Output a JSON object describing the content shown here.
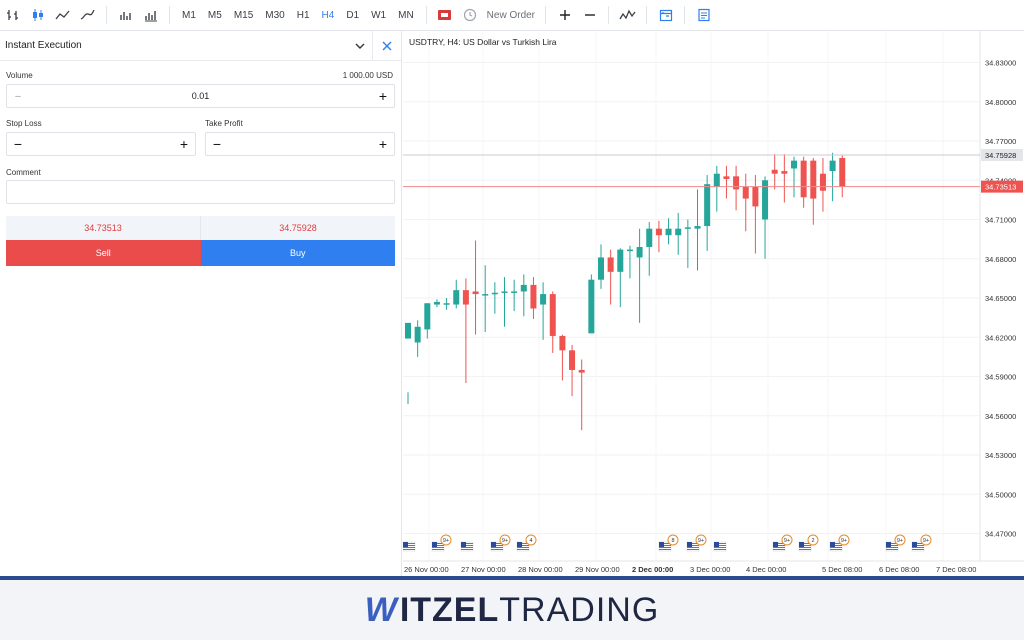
{
  "toolbar": {
    "timeframes": [
      "M1",
      "M5",
      "M15",
      "M30",
      "H1",
      "H4",
      "D1",
      "W1",
      "MN"
    ],
    "active_timeframe": "H4",
    "new_order_label": "New Order"
  },
  "order_panel": {
    "title": "Instant Execution",
    "volume_label": "Volume",
    "volume_value_usd": "1 000.00 USD",
    "volume": "0.01",
    "stop_loss_label": "Stop Loss",
    "take_profit_label": "Take Profit",
    "comment_label": "Comment",
    "sell_price": "34.73513",
    "buy_price": "34.75928",
    "sell_label": "Sell",
    "buy_label": "Buy"
  },
  "chart": {
    "title": "USDTRY, H4: US Dollar vs Turkish Lira",
    "price_labels": [
      "34.83000",
      "34.80000",
      "34.77000",
      "34.74000",
      "34.71000",
      "34.68000",
      "34.65000",
      "34.62000",
      "34.59000",
      "34.56000",
      "34.53000",
      "34.50000",
      "34.47000"
    ],
    "ask_price": "34.75928",
    "bid_price": "34.73513",
    "time_labels": [
      "26 Nov 00:00",
      "27 Nov 00:00",
      "28 Nov 00:00",
      "29 Nov 00:00",
      "2 Dec 00:00",
      "3 Dec 00:00",
      "4 Dec 00:00",
      "5 Dec 08:00",
      "6 Dec 08:00",
      "7 Dec 08:00"
    ],
    "event_badges": [
      "9+",
      "9+",
      "4",
      "8",
      "9+",
      "9+",
      "2",
      "9+",
      "9+",
      "9+"
    ]
  },
  "chart_data": {
    "type": "candlestick",
    "series": "USDTRY H4",
    "ylim": [
      34.455,
      34.845
    ],
    "candles": [
      [
        34.619,
        34.631,
        34.578,
        34.569
      ],
      [
        34.616,
        34.628,
        34.633,
        34.605
      ],
      [
        34.626,
        34.646,
        34.646,
        34.619
      ],
      [
        34.645,
        34.647,
        34.649,
        34.643
      ],
      [
        34.645,
        34.646,
        34.65,
        34.641
      ],
      [
        34.645,
        34.656,
        34.664,
        34.642
      ],
      [
        34.656,
        34.645,
        34.665,
        34.585
      ],
      [
        34.655,
        34.653,
        34.694,
        34.622
      ],
      [
        34.653,
        34.653,
        34.675,
        34.624
      ],
      [
        34.653,
        34.654,
        34.662,
        34.638
      ],
      [
        34.654,
        34.655,
        34.666,
        34.628
      ],
      [
        34.655,
        34.655,
        34.664,
        34.64
      ],
      [
        34.655,
        34.66,
        34.668,
        34.636
      ],
      [
        34.66,
        34.642,
        34.666,
        34.634
      ],
      [
        34.645,
        34.653,
        34.662,
        34.618
      ],
      [
        34.653,
        34.621,
        34.655,
        34.608
      ],
      [
        34.621,
        34.61,
        34.622,
        34.587
      ],
      [
        34.61,
        34.595,
        34.614,
        34.575
      ],
      [
        34.595,
        34.593,
        34.603,
        34.549
      ],
      [
        34.623,
        34.664,
        34.668,
        34.623
      ],
      [
        34.664,
        34.681,
        34.691,
        34.657
      ],
      [
        34.681,
        34.67,
        34.687,
        34.645
      ],
      [
        34.67,
        34.687,
        34.688,
        34.643
      ],
      [
        34.687,
        34.687,
        34.69,
        34.665
      ],
      [
        34.681,
        34.689,
        34.703,
        34.631
      ],
      [
        34.689,
        34.703,
        34.708,
        34.667
      ],
      [
        34.703,
        34.698,
        34.709,
        34.685
      ],
      [
        34.698,
        34.703,
        34.711,
        34.691
      ],
      [
        34.698,
        34.703,
        34.715,
        34.683
      ],
      [
        34.703,
        34.704,
        34.71,
        34.673
      ],
      [
        34.703,
        34.705,
        34.733,
        34.671
      ],
      [
        34.705,
        34.737,
        34.744,
        34.686
      ],
      [
        34.735,
        34.745,
        34.751,
        34.716
      ],
      [
        34.743,
        34.741,
        34.751,
        34.726
      ],
      [
        34.743,
        34.733,
        34.751,
        34.717
      ],
      [
        34.735,
        34.726,
        34.745,
        34.701
      ],
      [
        34.735,
        34.72,
        34.744,
        34.684
      ],
      [
        34.71,
        34.74,
        34.743,
        34.68
      ],
      [
        34.748,
        34.745,
        34.76,
        34.733
      ],
      [
        34.747,
        34.745,
        34.76,
        34.723
      ],
      [
        34.749,
        34.755,
        34.758,
        34.727
      ],
      [
        34.755,
        34.727,
        34.758,
        34.719
      ],
      [
        34.755,
        34.726,
        34.757,
        34.706
      ],
      [
        34.745,
        34.732,
        34.757,
        34.716
      ],
      [
        34.747,
        34.755,
        34.761,
        34.724
      ],
      [
        34.757,
        34.735,
        34.759,
        34.727
      ]
    ],
    "colors": {
      "up": "#26a69a",
      "down": "#ef5350"
    }
  }
}
